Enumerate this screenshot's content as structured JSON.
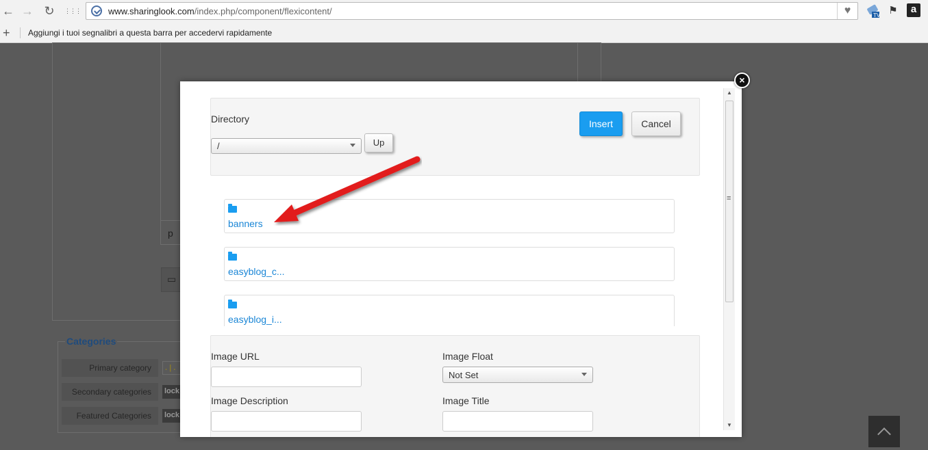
{
  "browser": {
    "url_domain": "www.sharinglook.com",
    "url_path": "/index.php/component/flexicontent/",
    "bookmarks_hint": "Aggiungi i tuoi segnalibri a questa barra per accedervi rapidamente",
    "plus_glyph": "+",
    "back_glyph": "←",
    "forward_glyph": "→",
    "reload_glyph": "↻",
    "apps_glyph": "⋮⋮⋮",
    "fav_glyph": "♥",
    "ext_bookmark_glyph": "⚑",
    "ext_amazon_glyph": "a"
  },
  "background": {
    "categories_title": "Categories",
    "primary_category": "Primary category",
    "secondary_categories": "Secondary categories",
    "featured_categories": "Featured Categories",
    "tag_text": "lock",
    "primary_tag": ". | .",
    "p_text": "p"
  },
  "modal": {
    "close_glyph": "×",
    "directory_label": "Directory",
    "directory_value": "/",
    "up_label": "Up",
    "insert_label": "Insert",
    "cancel_label": "Cancel",
    "folders": [
      {
        "name": "banners"
      },
      {
        "name": "easyblog_c..."
      },
      {
        "name": "easyblog_i..."
      }
    ],
    "image_url_label": "Image URL",
    "image_float_label": "Image Float",
    "image_float_value": "Not Set",
    "image_description_label": "Image Description",
    "image_title_label": "Image Title"
  },
  "colors": {
    "accent": "#1a9df0",
    "link": "#1a86d6",
    "annotation_arrow": "#e21b1b"
  }
}
